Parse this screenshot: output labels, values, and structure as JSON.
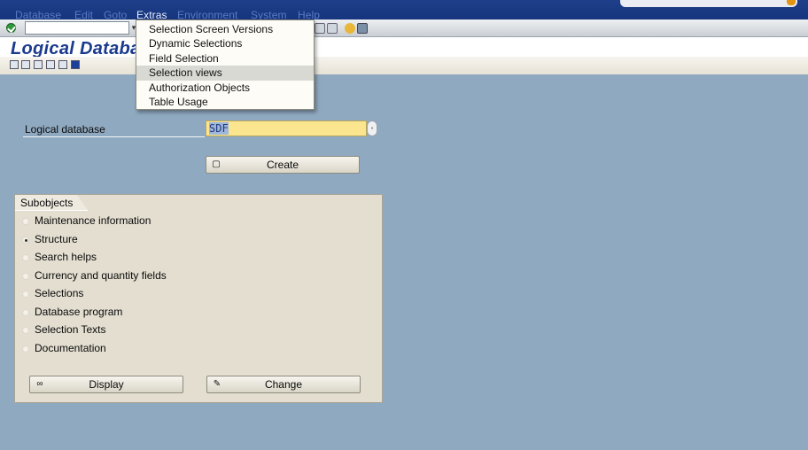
{
  "menubar": {
    "items": [
      {
        "label": "Database"
      },
      {
        "label": "Edit"
      },
      {
        "label": "Goto"
      },
      {
        "label": "Extras"
      },
      {
        "label": "Environment"
      },
      {
        "label": "System"
      },
      {
        "label": "Help"
      }
    ]
  },
  "extras_menu": {
    "items": [
      {
        "label": "Selection Screen Versions"
      },
      {
        "label": "Dynamic Selections"
      },
      {
        "label": "Field Selection"
      },
      {
        "label": "Selection views"
      },
      {
        "label": "Authorization Objects"
      },
      {
        "label": "Table Usage"
      }
    ],
    "highlighted_index": 3
  },
  "header": {
    "title": "Logical Databa"
  },
  "form": {
    "ldb_label": "Logical database",
    "ldb_value": "SDF",
    "create_label": "Create"
  },
  "subobjects": {
    "title": "Subobjects",
    "options": [
      {
        "label": "Maintenance information",
        "selected": false
      },
      {
        "label": "Structure",
        "selected": true
      },
      {
        "label": "Search helps",
        "selected": false
      },
      {
        "label": "Currency and quantity fields",
        "selected": false
      },
      {
        "label": "Selections",
        "selected": false
      },
      {
        "label": "Database program",
        "selected": false
      },
      {
        "label": "Selection Texts",
        "selected": false
      },
      {
        "label": "Documentation",
        "selected": false
      }
    ],
    "display_label": "Display",
    "change_label": "Change"
  },
  "colors": {
    "background": "#8fa9c0",
    "menubar": "#16357e",
    "title": "#1a3a8e",
    "input_required": "#fbe58f"
  }
}
